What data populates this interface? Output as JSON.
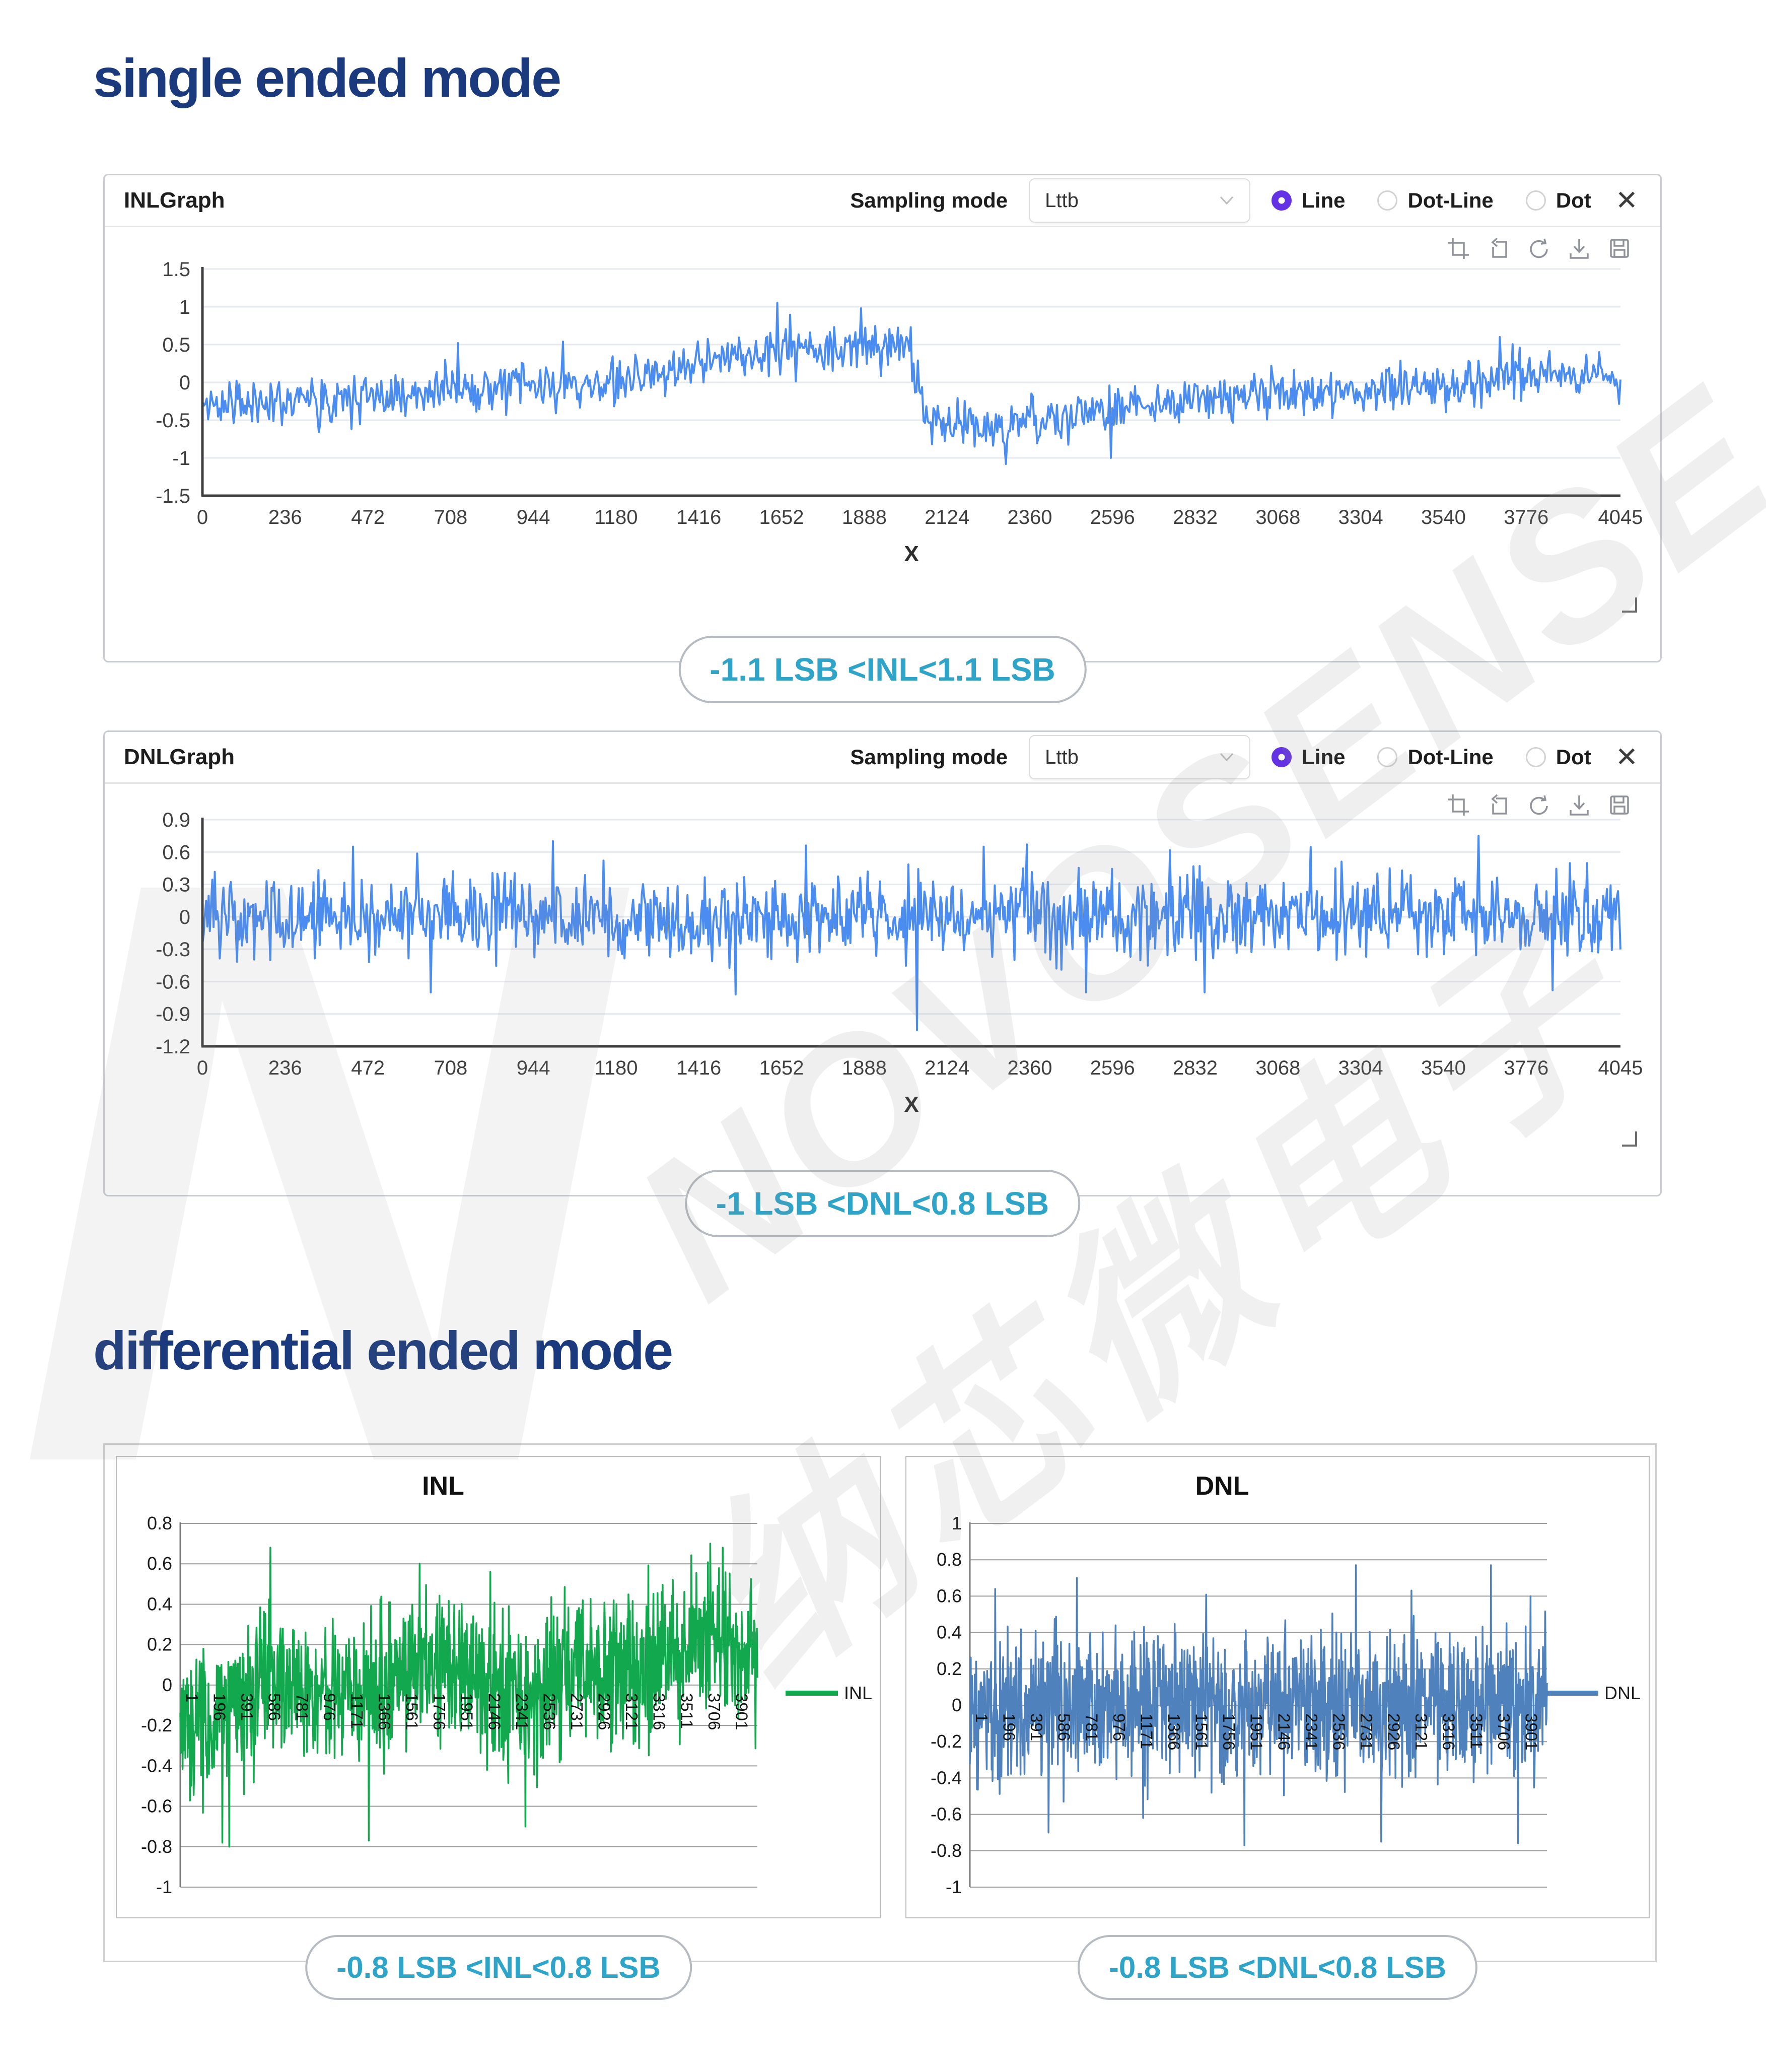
{
  "headings": {
    "single": "single ended mode",
    "differential": "differential ended mode"
  },
  "watermark": {
    "brand": "NOVOSENSE",
    "cjk": "纳芯微电子",
    "logo": "N"
  },
  "colors": {
    "heading_navy": "#1b3a7d",
    "badge_teal": "#2ea4c8",
    "line_blue": "#4b8cf0",
    "excel_green": "#12a84e",
    "excel_blue": "#4f81bd",
    "radio_purple": "#6431e3"
  },
  "panels": [
    {
      "title": "INLGraph",
      "sampling_label": "Sampling mode",
      "sampling_value": "Lttb",
      "radios": [
        {
          "label": "Line",
          "selected": true
        },
        {
          "label": "Dot-Line",
          "selected": false
        },
        {
          "label": "Dot",
          "selected": false
        }
      ],
      "close": "✕",
      "toolbar_icons": [
        "crop-icon",
        "history-back-icon",
        "refresh-icon",
        "download-icon",
        "save-icon"
      ],
      "badge": "-1.1 LSB <INL<1.1 LSB"
    },
    {
      "title": "DNLGraph",
      "sampling_label": "Sampling mode",
      "sampling_value": "Lttb",
      "radios": [
        {
          "label": "Line",
          "selected": true
        },
        {
          "label": "Dot-Line",
          "selected": false
        },
        {
          "label": "Dot",
          "selected": false
        }
      ],
      "close": "✕",
      "toolbar_icons": [
        "crop-icon",
        "history-back-icon",
        "refresh-icon",
        "download-icon",
        "save-icon"
      ],
      "badge": "-1 LSB <DNL<0.8 LSB"
    }
  ],
  "diff_section": {
    "badges": [
      "-0.8 LSB <INL<0.8 LSB",
      "-0.8 LSB <DNL<0.8 LSB"
    ]
  },
  "chart_data": [
    {
      "type": "line",
      "variant": "panel",
      "title": "INLGraph",
      "xlabel": "X",
      "xlim": [
        0,
        4045
      ],
      "ylim": [
        -1.5,
        1.5
      ],
      "grid": true,
      "legend_position": "none",
      "x_ticks": [
        0,
        236,
        472,
        708,
        944,
        1180,
        1416,
        1652,
        1888,
        2124,
        2360,
        2596,
        2832,
        3068,
        3304,
        3540,
        3776,
        4045
      ],
      "y_ticks": [
        1.5,
        1,
        0.5,
        0,
        -0.5,
        -1,
        -1.5
      ],
      "series": [
        {
          "name": "INL",
          "color": "#4b8cf0",
          "trend": [
            [
              0,
              -0.3
            ],
            [
              250,
              -0.22
            ],
            [
              550,
              -0.12
            ],
            [
              900,
              -0.05
            ],
            [
              1150,
              0.0
            ],
            [
              1350,
              0.18
            ],
            [
              1500,
              0.32
            ],
            [
              1700,
              0.45
            ],
            [
              1980,
              0.48
            ],
            [
              2020,
              0.42
            ],
            [
              2060,
              -0.5
            ],
            [
              2250,
              -0.58
            ],
            [
              2450,
              -0.5
            ],
            [
              2650,
              -0.32
            ],
            [
              2900,
              -0.18
            ],
            [
              3200,
              -0.12
            ],
            [
              3500,
              -0.05
            ],
            [
              3800,
              0.08
            ],
            [
              4045,
              0.05
            ]
          ],
          "noise": 0.2,
          "spikes": [
            [
              1640,
              1.05
            ],
            [
              1880,
              0.98
            ],
            [
              2290,
              -1.08
            ],
            [
              330,
              -0.66
            ],
            [
              730,
              0.52
            ],
            [
              2590,
              -1.0
            ],
            [
              3700,
              0.6
            ]
          ],
          "clip": [
            -1.1,
            1.07
          ],
          "seed": 11,
          "points": 1000,
          "range_note": "-1.1 LSB < INL < 1.1 LSB"
        }
      ]
    },
    {
      "type": "line",
      "variant": "panel",
      "title": "DNLGraph",
      "xlabel": "X",
      "xlim": [
        0,
        4045
      ],
      "ylim": [
        -1.2,
        0.9
      ],
      "grid": true,
      "legend_position": "none",
      "x_ticks": [
        0,
        236,
        472,
        708,
        944,
        1180,
        1416,
        1652,
        1888,
        2124,
        2360,
        2596,
        2832,
        3068,
        3304,
        3540,
        3776,
        4045
      ],
      "y_ticks": [
        0.9,
        0.6,
        0.3,
        0,
        -0.3,
        -0.6,
        -0.9,
        -1.2
      ],
      "series": [
        {
          "name": "DNL",
          "color": "#4b8cf0",
          "trend": [
            [
              0,
              0
            ],
            [
              4045,
              0
            ]
          ],
          "noise": 0.24,
          "spikes": [
            [
              430,
              0.65
            ],
            [
              1000,
              0.7
            ],
            [
              1720,
              0.66
            ],
            [
              2040,
              -1.05
            ],
            [
              2230,
              0.65
            ],
            [
              2350,
              0.67
            ],
            [
              3640,
              0.75
            ],
            [
              650,
              -0.7
            ],
            [
              1520,
              -0.72
            ],
            [
              2520,
              -0.7
            ],
            [
              2860,
              -0.7
            ],
            [
              3850,
              -0.68
            ]
          ],
          "clip": [
            -1.05,
            0.72
          ],
          "seed": 23,
          "points": 1150,
          "range_note": "-1 LSB < DNL < 0.8 LSB"
        }
      ]
    },
    {
      "type": "line",
      "variant": "excel",
      "title": "INL",
      "xlabel": "",
      "xlim": [
        1,
        4096
      ],
      "ylim": [
        -1,
        0.8
      ],
      "grid": true,
      "legend_position": "right",
      "categories": [
        1,
        196,
        391,
        586,
        781,
        976,
        1171,
        1366,
        1561,
        1756,
        1951,
        2146,
        2341,
        2536,
        2731,
        2926,
        3121,
        3316,
        3511,
        3706,
        3901
      ],
      "y_ticks": [
        0.8,
        0.6,
        0.4,
        0.2,
        0,
        -0.2,
        -0.4,
        -0.6,
        -0.8,
        -1
      ],
      "series": [
        {
          "name": "INL",
          "color": "#12a84e",
          "trend": [
            [
              1,
              -0.15
            ],
            [
              250,
              -0.2
            ],
            [
              450,
              -0.1
            ],
            [
              640,
              0.05
            ],
            [
              900,
              -0.05
            ],
            [
              1250,
              -0.02
            ],
            [
              1600,
              0.08
            ],
            [
              1900,
              0.12
            ],
            [
              2100,
              0.02
            ],
            [
              2450,
              -0.1
            ],
            [
              2800,
              0.1
            ],
            [
              3100,
              0.08
            ],
            [
              3400,
              0.12
            ],
            [
              3700,
              0.2
            ],
            [
              3901,
              0.22
            ],
            [
              4096,
              0.18
            ]
          ],
          "noise": 0.23,
          "spikes": [
            [
              300,
              -0.78
            ],
            [
              640,
              0.68
            ],
            [
              1340,
              -0.77
            ],
            [
              2450,
              -0.7
            ],
            [
              2200,
              0.56
            ],
            [
              3760,
              0.7
            ],
            [
              3850,
              0.68
            ],
            [
              1700,
              0.6
            ]
          ],
          "clip": [
            -0.8,
            0.72
          ],
          "seed": 37,
          "points": 1250,
          "range_note": "-0.8 LSB < INL < 0.8 LSB"
        }
      ]
    },
    {
      "type": "line",
      "variant": "excel",
      "title": "DNL",
      "xlabel": "",
      "xlim": [
        1,
        4096
      ],
      "ylim": [
        -1,
        1
      ],
      "grid": true,
      "legend_position": "right",
      "categories": [
        1,
        196,
        391,
        586,
        781,
        976,
        1171,
        1366,
        1561,
        1756,
        1951,
        2146,
        2341,
        2536,
        2731,
        2926,
        3121,
        3316,
        3511,
        3706,
        3901
      ],
      "y_ticks": [
        1,
        0.8,
        0.6,
        0.4,
        0.2,
        0,
        -0.2,
        -0.4,
        -0.6,
        -0.8,
        -1
      ],
      "series": [
        {
          "name": "DNL",
          "color": "#4f81bd",
          "trend": [
            [
              1,
              0
            ],
            [
              4096,
              0
            ]
          ],
          "noise": 0.25,
          "spikes": [
            [
              2740,
              0.77
            ],
            [
              3700,
              0.77
            ],
            [
              760,
              0.7
            ],
            [
              180,
              0.64
            ],
            [
              1950,
              -0.77
            ],
            [
              2920,
              -0.75
            ],
            [
              3890,
              -0.76
            ],
            [
              560,
              -0.7
            ],
            [
              1230,
              -0.62
            ]
          ],
          "clip": [
            -0.78,
            0.78
          ],
          "seed": 51,
          "points": 1300,
          "range_note": "-0.8 LSB < DNL < 0.8 LSB"
        }
      ]
    }
  ]
}
